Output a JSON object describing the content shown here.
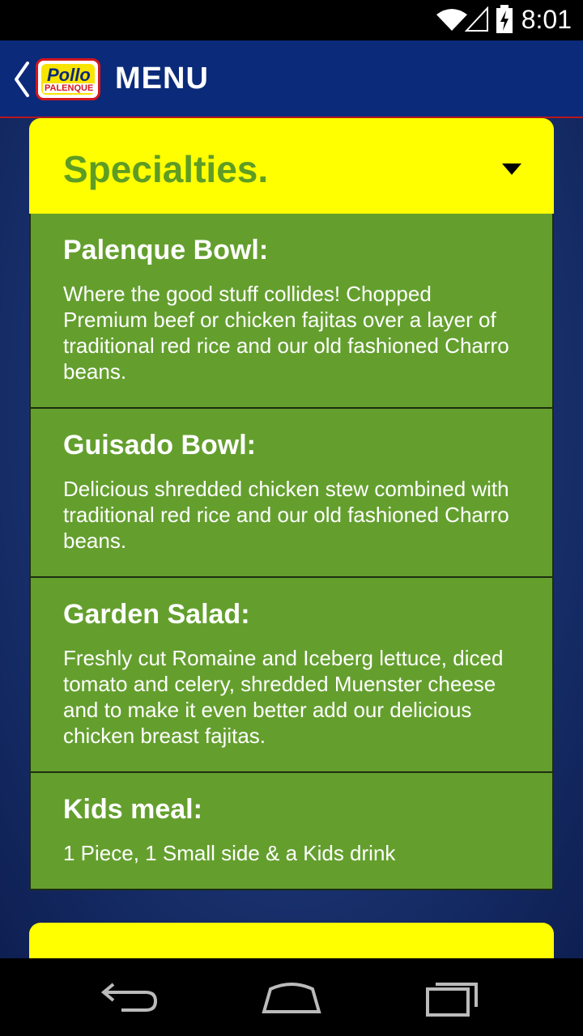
{
  "status_bar": {
    "time": "8:01",
    "icons": [
      "wifi-icon",
      "signal-icon",
      "battery-charging-icon"
    ]
  },
  "app_bar": {
    "title": "MENU",
    "logo": {
      "line1": "Pollo",
      "line2": "PALENQUE"
    },
    "back_icon": "chevron-left-icon"
  },
  "section": {
    "title": "Specialties.",
    "items": [
      {
        "title": "Palenque Bowl:",
        "description": "Where the good stuff collides! Chopped Premium beef or chicken fajitas over a layer of traditional red rice and our old fashioned Charro beans."
      },
      {
        "title": "Guisado Bowl:",
        "description": "Delicious shredded chicken stew combined with traditional red rice and our old fashioned Charro beans."
      },
      {
        "title": "Garden Salad:",
        "description": "Freshly cut Romaine and Iceberg lettuce, diced tomato and celery, shredded Muenster cheese and to make it even better add our delicious chicken breast fajitas."
      },
      {
        "title": "Kids meal:",
        "description": "1 Piece, 1 Small side & a Kids drink"
      }
    ]
  },
  "nav_bar": {
    "icons": [
      "back-icon",
      "home-icon",
      "recent-apps-icon"
    ]
  },
  "colors": {
    "app_bar": "#0b2a7a",
    "section_header": "#ffff00",
    "section_title": "#5e9c24",
    "item_background": "#649f2e"
  }
}
